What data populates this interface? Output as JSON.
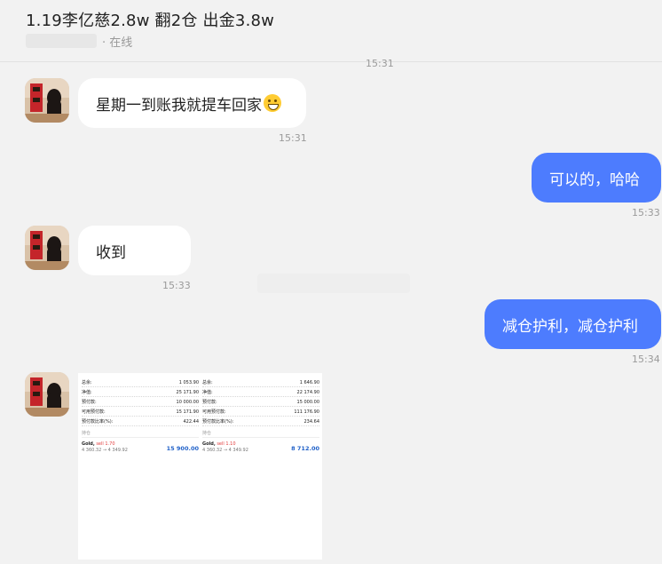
{
  "header": {
    "title": "1.19李亿慈2.8w 翻2仓 出金3.8w",
    "status": "· 在线"
  },
  "messages": [
    {
      "side": "meta",
      "time": "15:31"
    },
    {
      "side": "in",
      "text": "星期一到账我就提车回家",
      "emoji": "grinning-face-emoji",
      "time": "15:31"
    },
    {
      "side": "out",
      "text": "可以的，哈哈",
      "time": "15:33"
    },
    {
      "side": "in",
      "text": "收到",
      "time": "15:33"
    },
    {
      "side": "out",
      "text": "减仓护利，减仓护利",
      "time": "15:34"
    }
  ],
  "image_message": {
    "left": {
      "rows": [
        {
          "label": "总余:",
          "value": "1 053.90"
        },
        {
          "label": "净值:",
          "value": "25 171.90"
        },
        {
          "label": "预付款:",
          "value": "10 000.00"
        },
        {
          "label": "可用预付款:",
          "value": "15 171.90"
        },
        {
          "label": "预付款比率(%):",
          "value": "422.44"
        }
      ],
      "caption": "持仓",
      "trade": {
        "symbol": "Gold,",
        "type": "sell",
        "lots": "1.70",
        "prices": "4 360.32 → 4 349.92",
        "profit": "15 900.00"
      }
    },
    "right": {
      "rows": [
        {
          "label": "总余:",
          "value": "1 646.90"
        },
        {
          "label": "净值:",
          "value": "22 174.90"
        },
        {
          "label": "预付款:",
          "value": "15 000.00"
        },
        {
          "label": "可用预付款:",
          "value": "111 176.90"
        },
        {
          "label": "预付款比率(%):",
          "value": "234.64"
        }
      ],
      "caption": "持仓",
      "trade": {
        "symbol": "Gold,",
        "type": "sell",
        "lots": "1.10",
        "prices": "4 360.32 → 4 349.92",
        "profit": "8 712.00"
      }
    }
  },
  "colors": {
    "outgoing_bubble": "#4d7cfe",
    "incoming_bubble": "#ffffff",
    "background": "#f2f2f2"
  }
}
